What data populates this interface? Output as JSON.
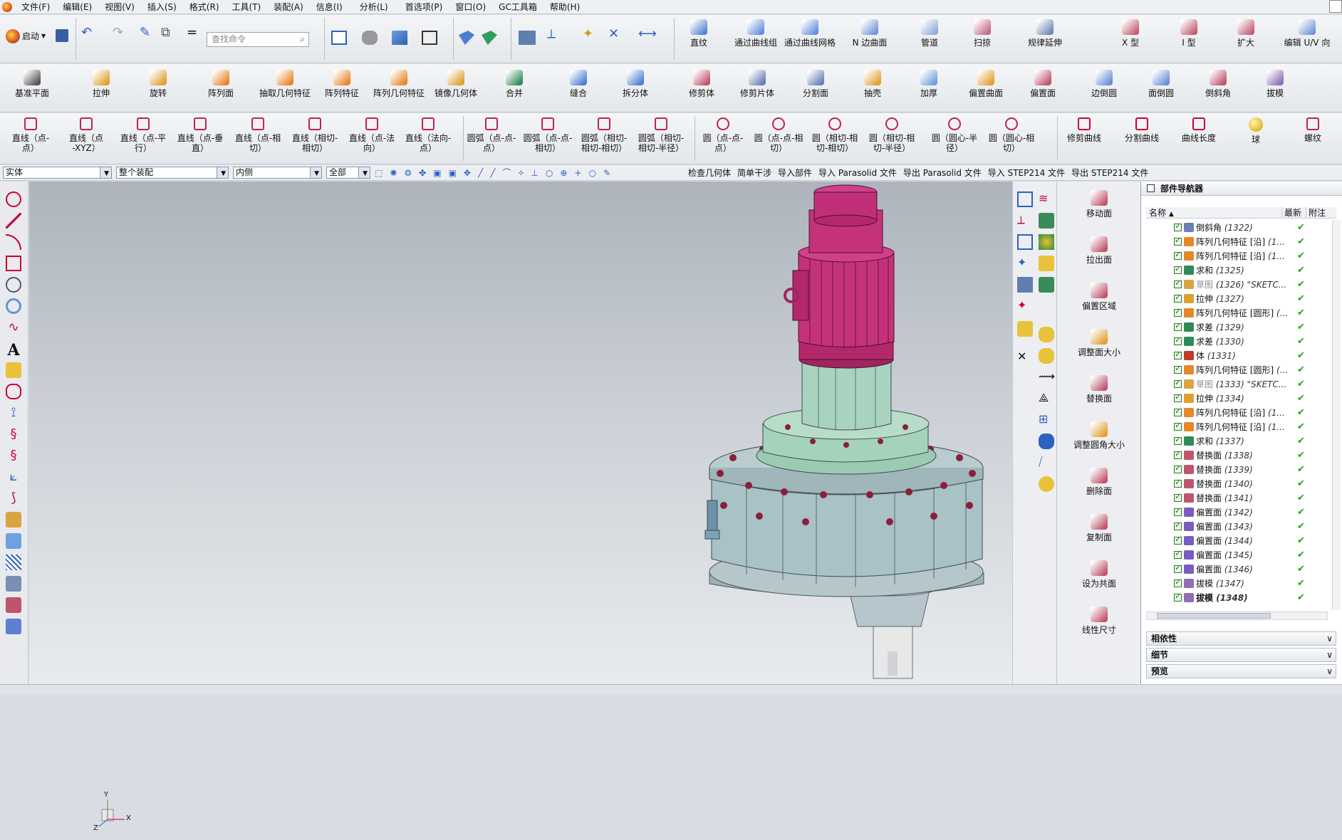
{
  "menu": [
    "文件(F)",
    "编辑(E)",
    "视图(V)",
    "插入(S)",
    "格式(R)",
    "工具(T)",
    "装配(A)",
    "信息(I)",
    "分析(L)",
    "首选项(P)",
    "窗口(O)",
    "GC工具箱",
    "帮助(H)"
  ],
  "row1": {
    "start": "启动",
    "search_placeholder": "查找命令",
    "items": [
      "直纹",
      "通过曲线组",
      "通过曲线网格",
      "N 边曲面",
      "管道",
      "扫掠",
      "规律延伸",
      "X 型",
      "I 型",
      "扩大",
      "编辑 U/V 向"
    ]
  },
  "row2": [
    "基准平面",
    "拉伸",
    "旋转",
    "阵列面",
    "抽取几何特征",
    "阵列特征",
    "阵列几何特征",
    "镜像几何体",
    "合并",
    "缝合",
    "拆分体",
    "修剪体",
    "修剪片体",
    "分割面",
    "抽壳",
    "加厚",
    "偏置曲面",
    "偏置面",
    "边倒圆",
    "面倒圆",
    "倒斜角",
    "拔模"
  ],
  "row3": [
    [
      "直线（点-",
      "点）"
    ],
    [
      "直线（点",
      "-XYZ）"
    ],
    [
      "直线（点-平",
      "行）"
    ],
    [
      "直线（点-垂",
      "直）"
    ],
    [
      "直线（点-相",
      "切）"
    ],
    [
      "直线（相切-",
      "相切）"
    ],
    [
      "直线（点-法",
      "向）"
    ],
    [
      "直线（法向-",
      "点）"
    ],
    [
      "圆弧（点-点-",
      "点）"
    ],
    [
      "圆弧（点-点-",
      "相切）"
    ],
    [
      "圆弧（相切-",
      "相切-相切）"
    ],
    [
      "圆弧（相切-",
      "相切-半径）"
    ],
    [
      "圆（点-点-",
      "点）"
    ],
    [
      "圆（点-点-相",
      "切）"
    ],
    [
      "圆（相切-相",
      "切-相切）"
    ],
    [
      "圆（相切-相",
      "切-半径）"
    ],
    [
      "圆（圆心-半",
      "径）"
    ],
    [
      "圆（圆心-相",
      "切）"
    ],
    [
      "修剪曲线",
      ""
    ],
    [
      "分割曲线",
      ""
    ],
    [
      "曲线长度",
      ""
    ],
    [
      "球",
      ""
    ],
    [
      "螺纹",
      ""
    ]
  ],
  "filters": {
    "type": "实体",
    "scope": "整个装配",
    "side": "内侧",
    "all": "全部"
  },
  "row4_commands": [
    "检查几何体",
    "简单干涉",
    "导入部件",
    "导入 Parasolid 文件",
    "导出 Parasolid 文件",
    "导入 STEP214 文件",
    "导出 STEP214 文件"
  ],
  "sync_tools": [
    "移动面",
    "拉出面",
    "偏置区域",
    "调整面大小",
    "替换面",
    "调整圆角大小",
    "删除面",
    "复制面",
    "设为共面",
    "线性尺寸"
  ],
  "navigator": {
    "title": "部件导航器",
    "col_name": "名称",
    "col_latest": "最新",
    "col_note": "附注",
    "rows": [
      {
        "name": "倒斜角",
        "id": "(1322)",
        "color": "#6a7fb5",
        "dim": false,
        "bold": false
      },
      {
        "name": "阵列几何特征 [沿]",
        "id": "(1...",
        "color": "#e8862a",
        "dim": false,
        "bold": false
      },
      {
        "name": "阵列几何特征 [沿]",
        "id": "(1...",
        "color": "#e8862a",
        "dim": false,
        "bold": false
      },
      {
        "name": "求和",
        "id": "(1325)",
        "color": "#2e8b57",
        "dim": false,
        "bold": false
      },
      {
        "name": "草图",
        "id": "(1326) \"SKETC...",
        "color": "#d9a441",
        "dim": true,
        "bold": false
      },
      {
        "name": "拉伸",
        "id": "(1327)",
        "color": "#e0a030",
        "dim": false,
        "bold": false
      },
      {
        "name": "阵列几何特征 [圆形]",
        "id": "(...",
        "color": "#e8862a",
        "dim": false,
        "bold": false
      },
      {
        "name": "求差",
        "id": "(1329)",
        "color": "#2e8b57",
        "dim": false,
        "bold": false
      },
      {
        "name": "求差",
        "id": "(1330)",
        "color": "#2e8b57",
        "dim": false,
        "bold": false
      },
      {
        "name": "体",
        "id": "(1331)",
        "color": "#c0392b",
        "dim": false,
        "bold": false
      },
      {
        "name": "阵列几何特征 [圆形]",
        "id": "(...",
        "color": "#e8862a",
        "dim": false,
        "bold": false
      },
      {
        "name": "草图",
        "id": "(1333) \"SKETC...",
        "color": "#d9a441",
        "dim": true,
        "bold": false
      },
      {
        "name": "拉伸",
        "id": "(1334)",
        "color": "#e0a030",
        "dim": false,
        "bold": false
      },
      {
        "name": "阵列几何特征 [沿]",
        "id": "(1...",
        "color": "#e8862a",
        "dim": false,
        "bold": false
      },
      {
        "name": "阵列几何特征 [沿]",
        "id": "(1...",
        "color": "#e8862a",
        "dim": false,
        "bold": false
      },
      {
        "name": "求和",
        "id": "(1337)",
        "color": "#2e8b57",
        "dim": false,
        "bold": false
      },
      {
        "name": "替换面",
        "id": "(1338)",
        "color": "#c0546d",
        "dim": false,
        "bold": false
      },
      {
        "name": "替换面",
        "id": "(1339)",
        "color": "#c0546d",
        "dim": false,
        "bold": false
      },
      {
        "name": "替换面",
        "id": "(1340)",
        "color": "#c0546d",
        "dim": false,
        "bold": false
      },
      {
        "name": "替换面",
        "id": "(1341)",
        "color": "#c0546d",
        "dim": false,
        "bold": false
      },
      {
        "name": "偏置面",
        "id": "(1342)",
        "color": "#7a5bc4",
        "dim": false,
        "bold": false
      },
      {
        "name": "偏置面",
        "id": "(1343)",
        "color": "#7a5bc4",
        "dim": false,
        "bold": false
      },
      {
        "name": "偏置面",
        "id": "(1344)",
        "color": "#7a5bc4",
        "dim": false,
        "bold": false
      },
      {
        "name": "偏置面",
        "id": "(1345)",
        "color": "#7a5bc4",
        "dim": false,
        "bold": false
      },
      {
        "name": "偏置面",
        "id": "(1346)",
        "color": "#7a5bc4",
        "dim": false,
        "bold": false
      },
      {
        "name": "拔模",
        "id": "(1347)",
        "color": "#8e6fb3",
        "dim": false,
        "bold": false
      },
      {
        "name": "拔模",
        "id": "(1348)",
        "color": "#8e6fb3",
        "dim": false,
        "bold": true
      }
    ],
    "panes": [
      "相依性",
      "细节",
      "预览"
    ]
  },
  "axis": {
    "x": "X",
    "y": "Y",
    "z": "Z"
  },
  "colors": {
    "motor": "#b3286a",
    "housing": "#a9c2c6",
    "flange": "#9ccbb4",
    "bolt": "#8a1f3a",
    "accent": "#2b62c6"
  }
}
